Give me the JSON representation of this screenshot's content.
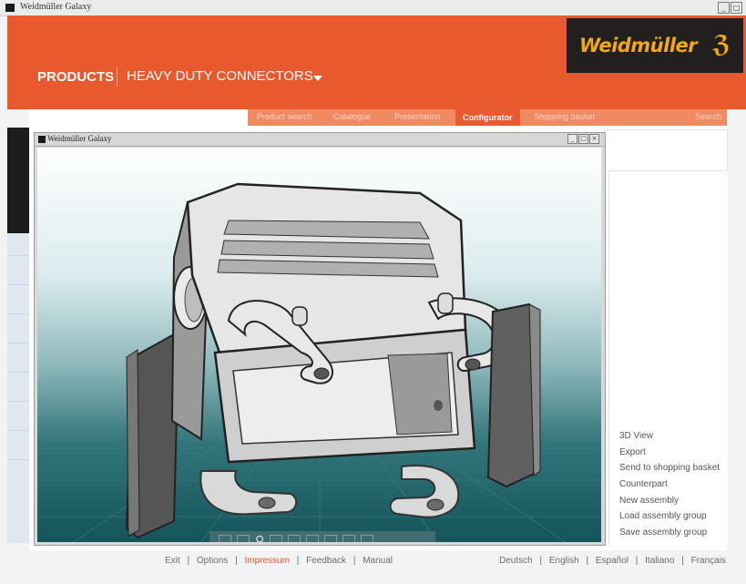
{
  "window": {
    "title": "Weidmüller Galaxy",
    "controls": [
      "_",
      "□",
      "×"
    ]
  },
  "brand": {
    "name": "Weidmüller",
    "glyph": "ℨ"
  },
  "header": {
    "section": "PRODUCTS",
    "product_line": "HEAVY DUTY CONNECTORS"
  },
  "tabs": [
    {
      "label": "Product search"
    },
    {
      "label": "Catalogue"
    },
    {
      "label": "Presentation"
    },
    {
      "label": "Configurator",
      "active": true
    },
    {
      "label": "Shopping basket"
    },
    {
      "label": "Search"
    }
  ],
  "inner_window": {
    "title": "Weidmüller Galaxy",
    "controls": [
      "_",
      "□",
      "×"
    ]
  },
  "side_menu": [
    "3D View",
    "Export",
    "Send to shopping basket",
    "Counterpart",
    "New assembly",
    "Load assembly group",
    "Save assembly group"
  ],
  "viewer_toolbar": {
    "tools": [
      "view-icon",
      "search-icon",
      "pan-icon",
      "rotate-icon",
      "zoom-icon",
      "reset-icon"
    ]
  },
  "footer": {
    "links_left": [
      "Exit",
      "Options",
      "Impressum",
      "Feedback",
      "Manual"
    ],
    "highlight": "Impressum",
    "languages": [
      "Deutsch",
      "English",
      "Español",
      "Italiano",
      "Français"
    ],
    "separator": "|"
  },
  "colors": {
    "brand_orange": "#e8592e",
    "logo_gold": "#f3a712",
    "logo_bg": "#221f1f",
    "viewport_teal": "#14545a"
  }
}
